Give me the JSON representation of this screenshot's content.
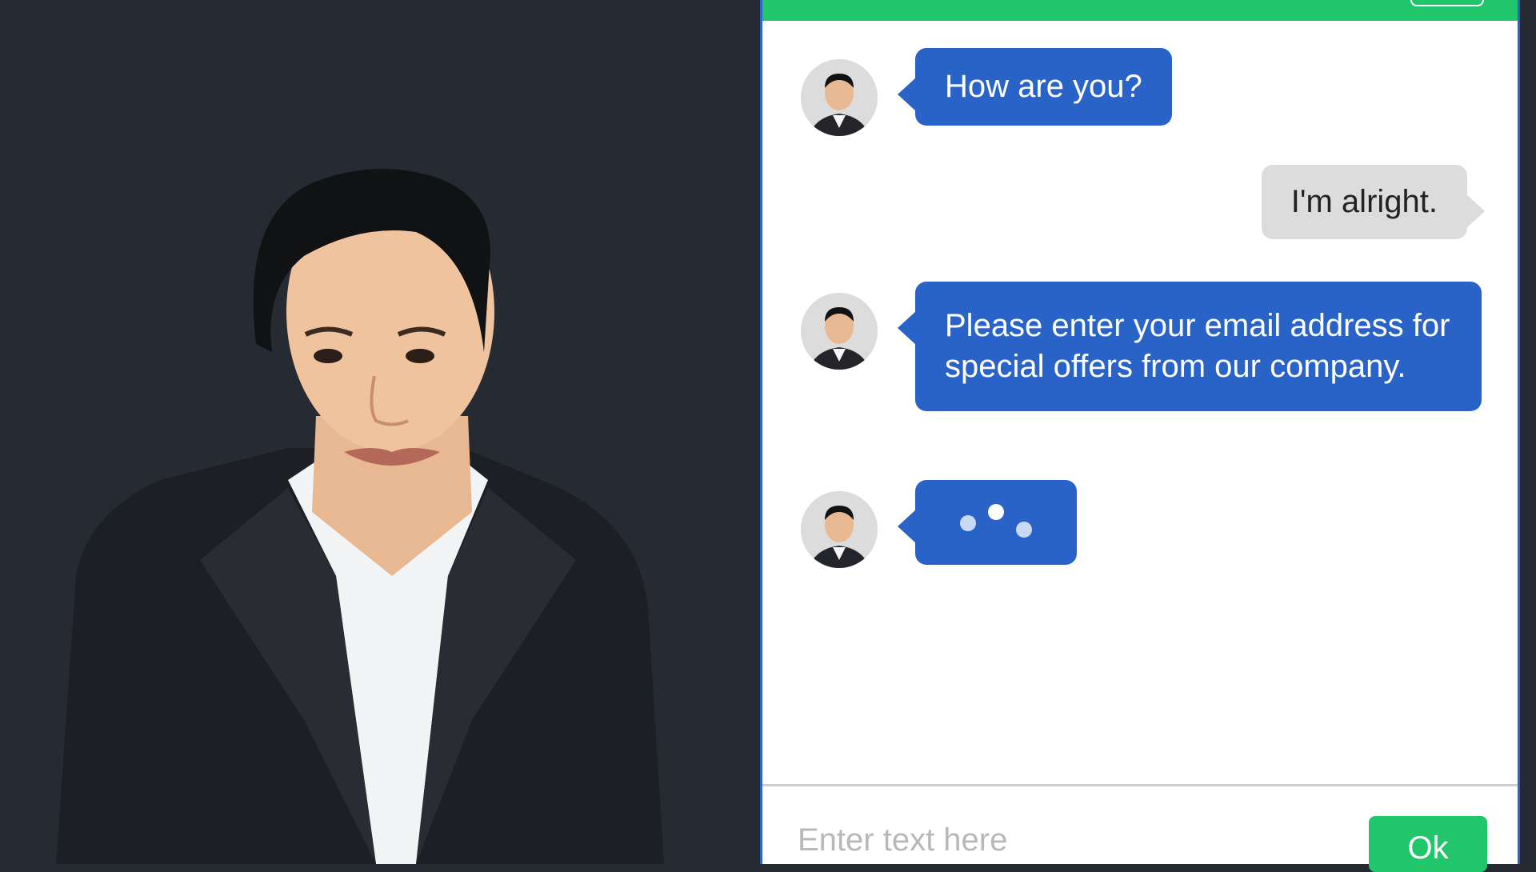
{
  "colors": {
    "background": "#262a33",
    "header": "#22c66a",
    "bot_bubble": "#2a63c8",
    "user_bubble": "#dcdcdc",
    "ok_button": "#22c66a"
  },
  "chat": {
    "messages": [
      {
        "sender": "bot",
        "text": "How are you?"
      },
      {
        "sender": "user",
        "text": "I'm alright."
      },
      {
        "sender": "bot",
        "text": "Please enter your email address for special offers from our company."
      },
      {
        "sender": "bot",
        "typing": true
      }
    ],
    "input_placeholder": "Enter text here",
    "ok_label": "Ok"
  },
  "icons": {
    "avatar": "agent-avatar-icon",
    "typing": "typing-indicator-icon"
  }
}
